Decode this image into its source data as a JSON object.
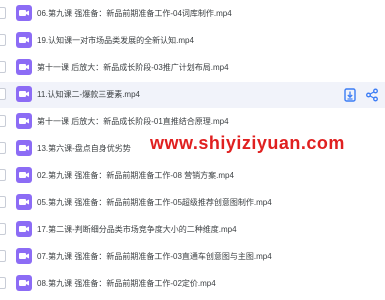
{
  "files": [
    {
      "name": "06.第九课 强准备：新品前期准备工作-04词库制作.mp4"
    },
    {
      "name": "19.认知课一对市场品类发展的全新认知.mp4"
    },
    {
      "name": "第十一课 后放大：新品成长阶段-03推广计划布局.mp4"
    },
    {
      "name": "11.认知课二-爆款三要素.mp4"
    },
    {
      "name": "第十一课 后放大：新品成长阶段-01直推结合原理.mp4"
    },
    {
      "name": "13.第六课-盘点自身优劣势"
    },
    {
      "name": "02.第九课 强准备：新品前期准备工作-08 营销方案.mp4"
    },
    {
      "name": "05.第九课 强准备：新品前期准备工作-05超级推荐创意图制作.mp4"
    },
    {
      "name": "17.第二课-判断细分品类市场竞争度大小的二种维度.mp4"
    },
    {
      "name": "07.第九课 强准备：新品前期准备工作-03直通车创意图与主图.mp4"
    },
    {
      "name": "08.第九课 强准备：新品前期准备工作-02定价.mp4"
    }
  ],
  "watermark": "www.shiyiziyuan.com",
  "colors": {
    "video_icon": "#8c6cf5",
    "action_icon": "#3b7cf5",
    "watermark": "#e02020",
    "hover_row": "#f1f3fa"
  },
  "icons": {
    "file_type": "video-icon",
    "row_actions": [
      "download-icon",
      "share-icon"
    ]
  }
}
